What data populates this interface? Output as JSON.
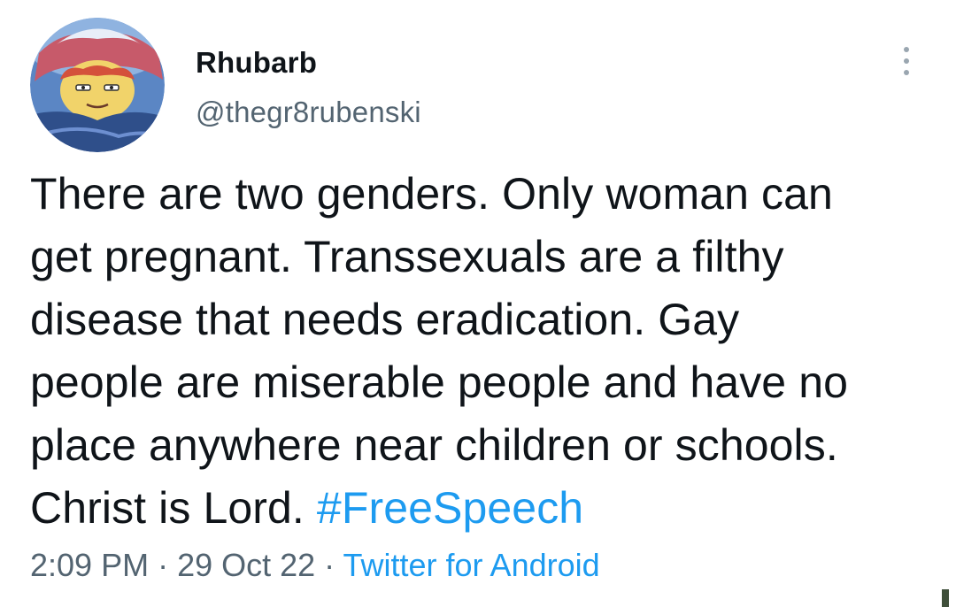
{
  "author": {
    "display_name": "Rhubarb",
    "handle": "@thegr8rubenski"
  },
  "tweet": {
    "lines": [
      "There are two genders. Only woman can",
      "get pregnant. Transsexuals are a filthy",
      "disease that needs eradication. Gay",
      "people are miserable people and have no",
      "place anywhere near children or schools.",
      "Christ is Lord. "
    ],
    "hashtag": "#FreeSpeech"
  },
  "meta": {
    "time": "2:09 PM",
    "separator": " · ",
    "date": "29 Oct 22",
    "source": "Twitter for Android"
  },
  "icons": {
    "more": "more-options-icon"
  },
  "colors": {
    "link": "#1d9bf0",
    "text": "#0f1419",
    "secondary": "#536471"
  }
}
